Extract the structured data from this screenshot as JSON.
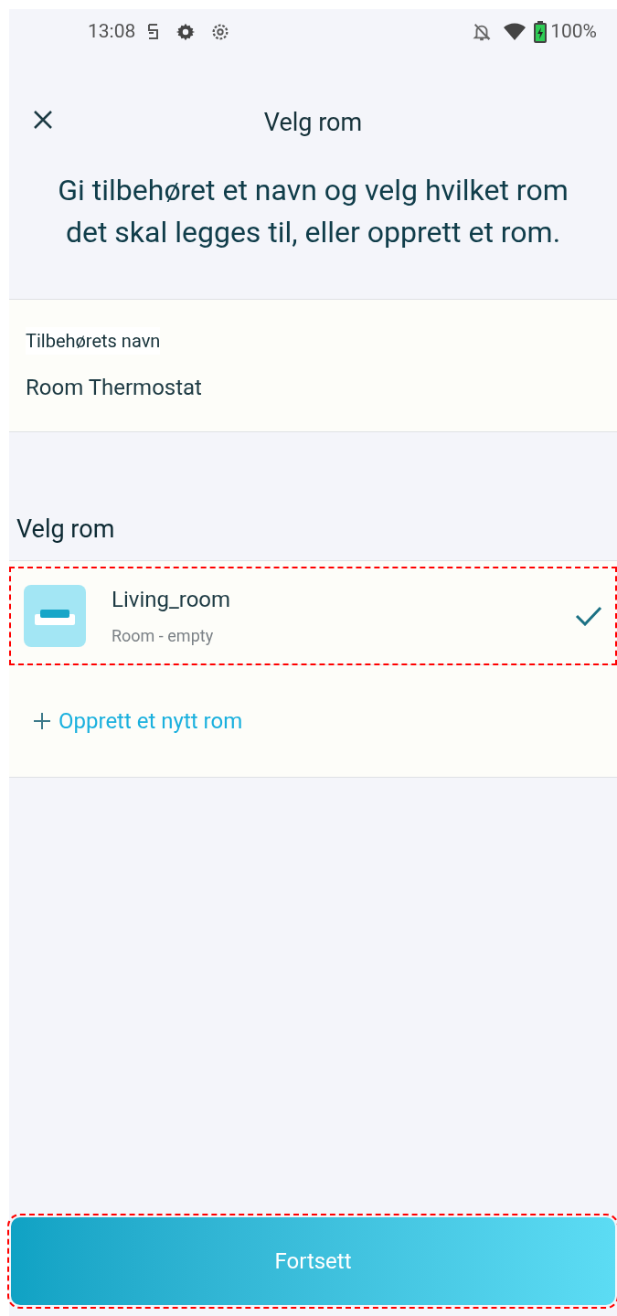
{
  "status_bar": {
    "time": "13:08",
    "battery": "100%"
  },
  "header": {
    "title": "Velg rom",
    "subtitle": "Gi tilbehøret et navn og velg hvilket rom det skal legges til, eller opprett et rom."
  },
  "name_field": {
    "label": "Tilbehørets navn",
    "value": "Room Thermostat"
  },
  "room_section": {
    "heading": "Velg rom",
    "rooms": [
      {
        "name": "Living_room",
        "subtitle": "Room - empty",
        "selected": true,
        "highlighted": true
      }
    ],
    "create_link": "Opprett et nytt rom"
  },
  "continue_button": {
    "label": "Fortsett",
    "highlighted": true
  }
}
